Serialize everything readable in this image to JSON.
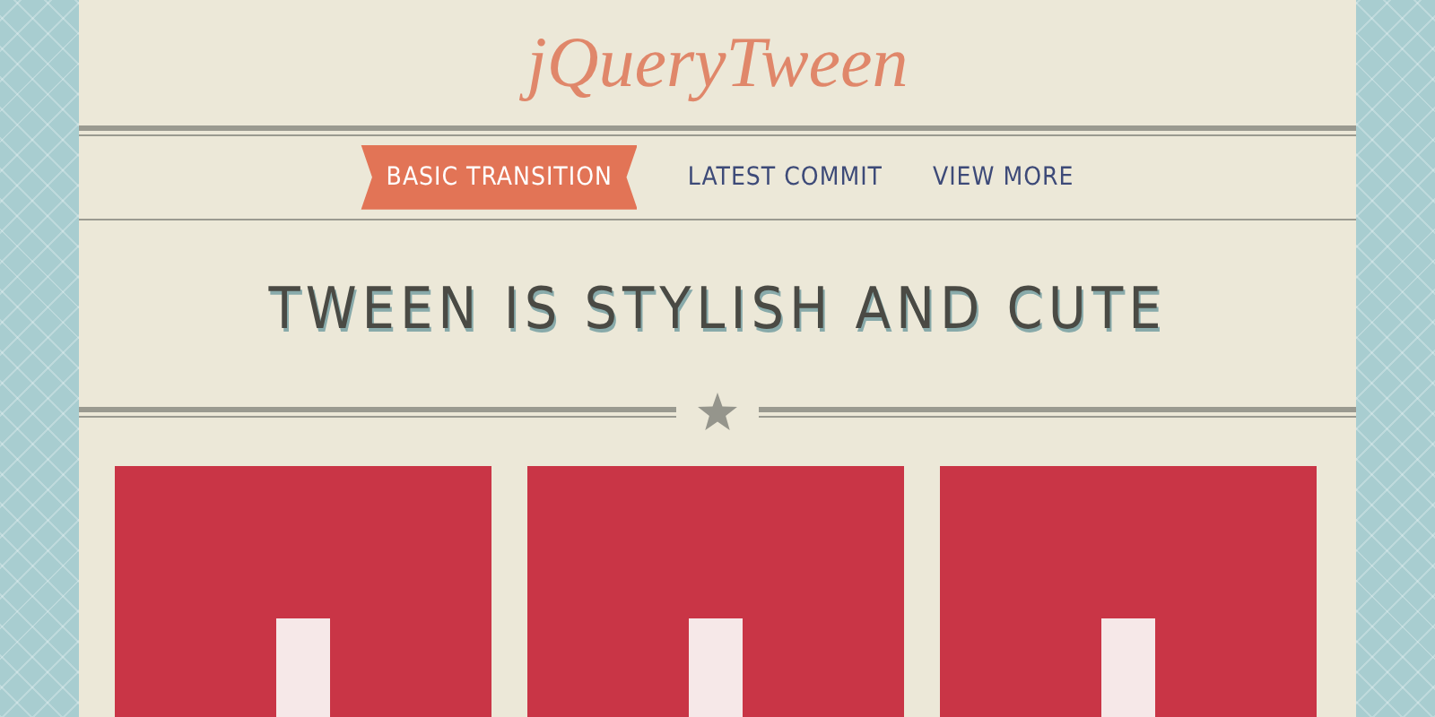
{
  "logo": "jQueryTween",
  "nav": [
    {
      "label": "BASIC TRANSITION",
      "selected": true
    },
    {
      "label": "LATEST COMMIT",
      "selected": false
    },
    {
      "label": "VIEW MORE",
      "selected": false
    }
  ],
  "heading": "TWEEN IS STYLISH AND CUTE"
}
